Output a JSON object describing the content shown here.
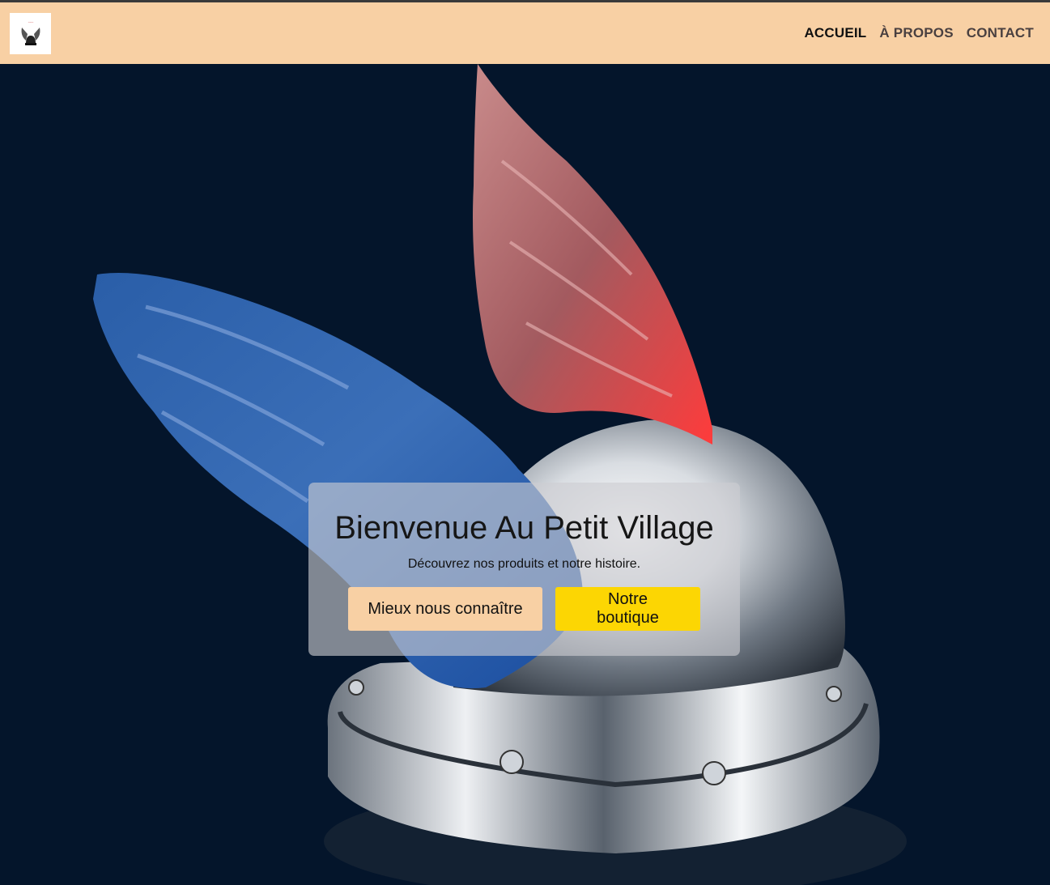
{
  "nav": {
    "logo_alt": "Au Petit Village",
    "items": [
      {
        "label": "ACCUEIL",
        "active": true
      },
      {
        "label": "À PROPOS",
        "active": false
      },
      {
        "label": "CONTACT",
        "active": false
      }
    ]
  },
  "hero": {
    "image": "winged-helmet",
    "title": "Bienvenue Au Petit Village",
    "subtitle": "Découvrez nos produits et notre histoire.",
    "primary_button": "Mieux nous connaître",
    "secondary_button": "Notre boutique"
  },
  "colors": {
    "navbar": "#f8d0a4",
    "background": "#04152b",
    "primary_button": "#f8d0a4",
    "secondary_button": "#fcd603"
  }
}
